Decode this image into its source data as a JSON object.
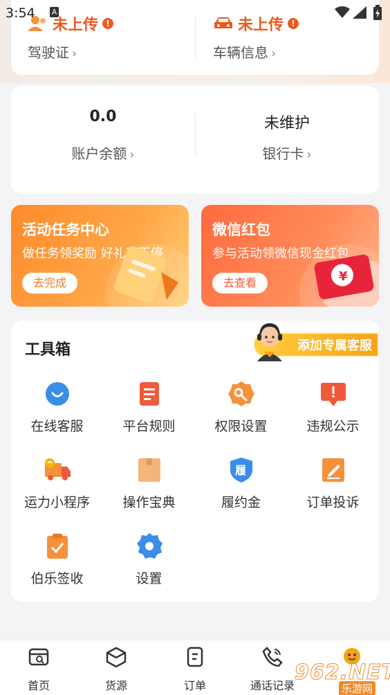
{
  "status_bar": {
    "time": "3:54",
    "notif_glyph": "A"
  },
  "cert_card": {
    "license": {
      "status": "未上传",
      "label": "驾驶证",
      "icon": "person-icon"
    },
    "vehicle": {
      "status": "未上传",
      "label": "车辆信息",
      "icon": "car-icon"
    },
    "chevron": "›",
    "warn_glyph": "!"
  },
  "account_card": {
    "balance": {
      "value": "0.0",
      "label": "账户余额"
    },
    "bank": {
      "value": "未维护",
      "label": "银行卡"
    },
    "chevron": "›"
  },
  "promos": [
    {
      "title": "活动任务中心",
      "subtitle": "做任务领奖励 好礼享不停",
      "button": "去完成",
      "icon": "tag-icon"
    },
    {
      "title": "微信红包",
      "subtitle": "参与活动领微信现金红包",
      "button": "去查看",
      "icon": "red-envelope-icon",
      "badge": "¥"
    }
  ],
  "toolbox": {
    "title": "工具箱",
    "support_banner": "添加专属客服",
    "items": [
      {
        "label": "在线客服",
        "icon": "chat-bubble-icon"
      },
      {
        "label": "平台规则",
        "icon": "document-icon"
      },
      {
        "label": "权限设置",
        "icon": "key-gear-icon"
      },
      {
        "label": "违规公示",
        "icon": "alert-board-icon"
      },
      {
        "label": "运力小程序",
        "icon": "truck-icon"
      },
      {
        "label": "操作宝典",
        "icon": "book-icon"
      },
      {
        "label": "履约金",
        "icon": "shield-icon",
        "icon_text": "履"
      },
      {
        "label": "订单投诉",
        "icon": "edit-icon"
      },
      {
        "label": "伯乐签收",
        "icon": "clipboard-check-icon"
      },
      {
        "label": "设置",
        "icon": "gear-icon"
      }
    ]
  },
  "bottom_nav": [
    {
      "label": "首页",
      "icon": "home-search-icon"
    },
    {
      "label": "货源",
      "icon": "cube-icon"
    },
    {
      "label": "订单",
      "icon": "order-icon"
    },
    {
      "label": "通话记录",
      "icon": "phone-icon"
    }
  ],
  "watermark": {
    "text": "962.NET",
    "sub": "乐游网"
  },
  "colors": {
    "accent_orange": "#ea5a1e",
    "icon_blue": "#3a8dea",
    "icon_red": "#ef5a3c",
    "icon_orange": "#f5913a"
  }
}
